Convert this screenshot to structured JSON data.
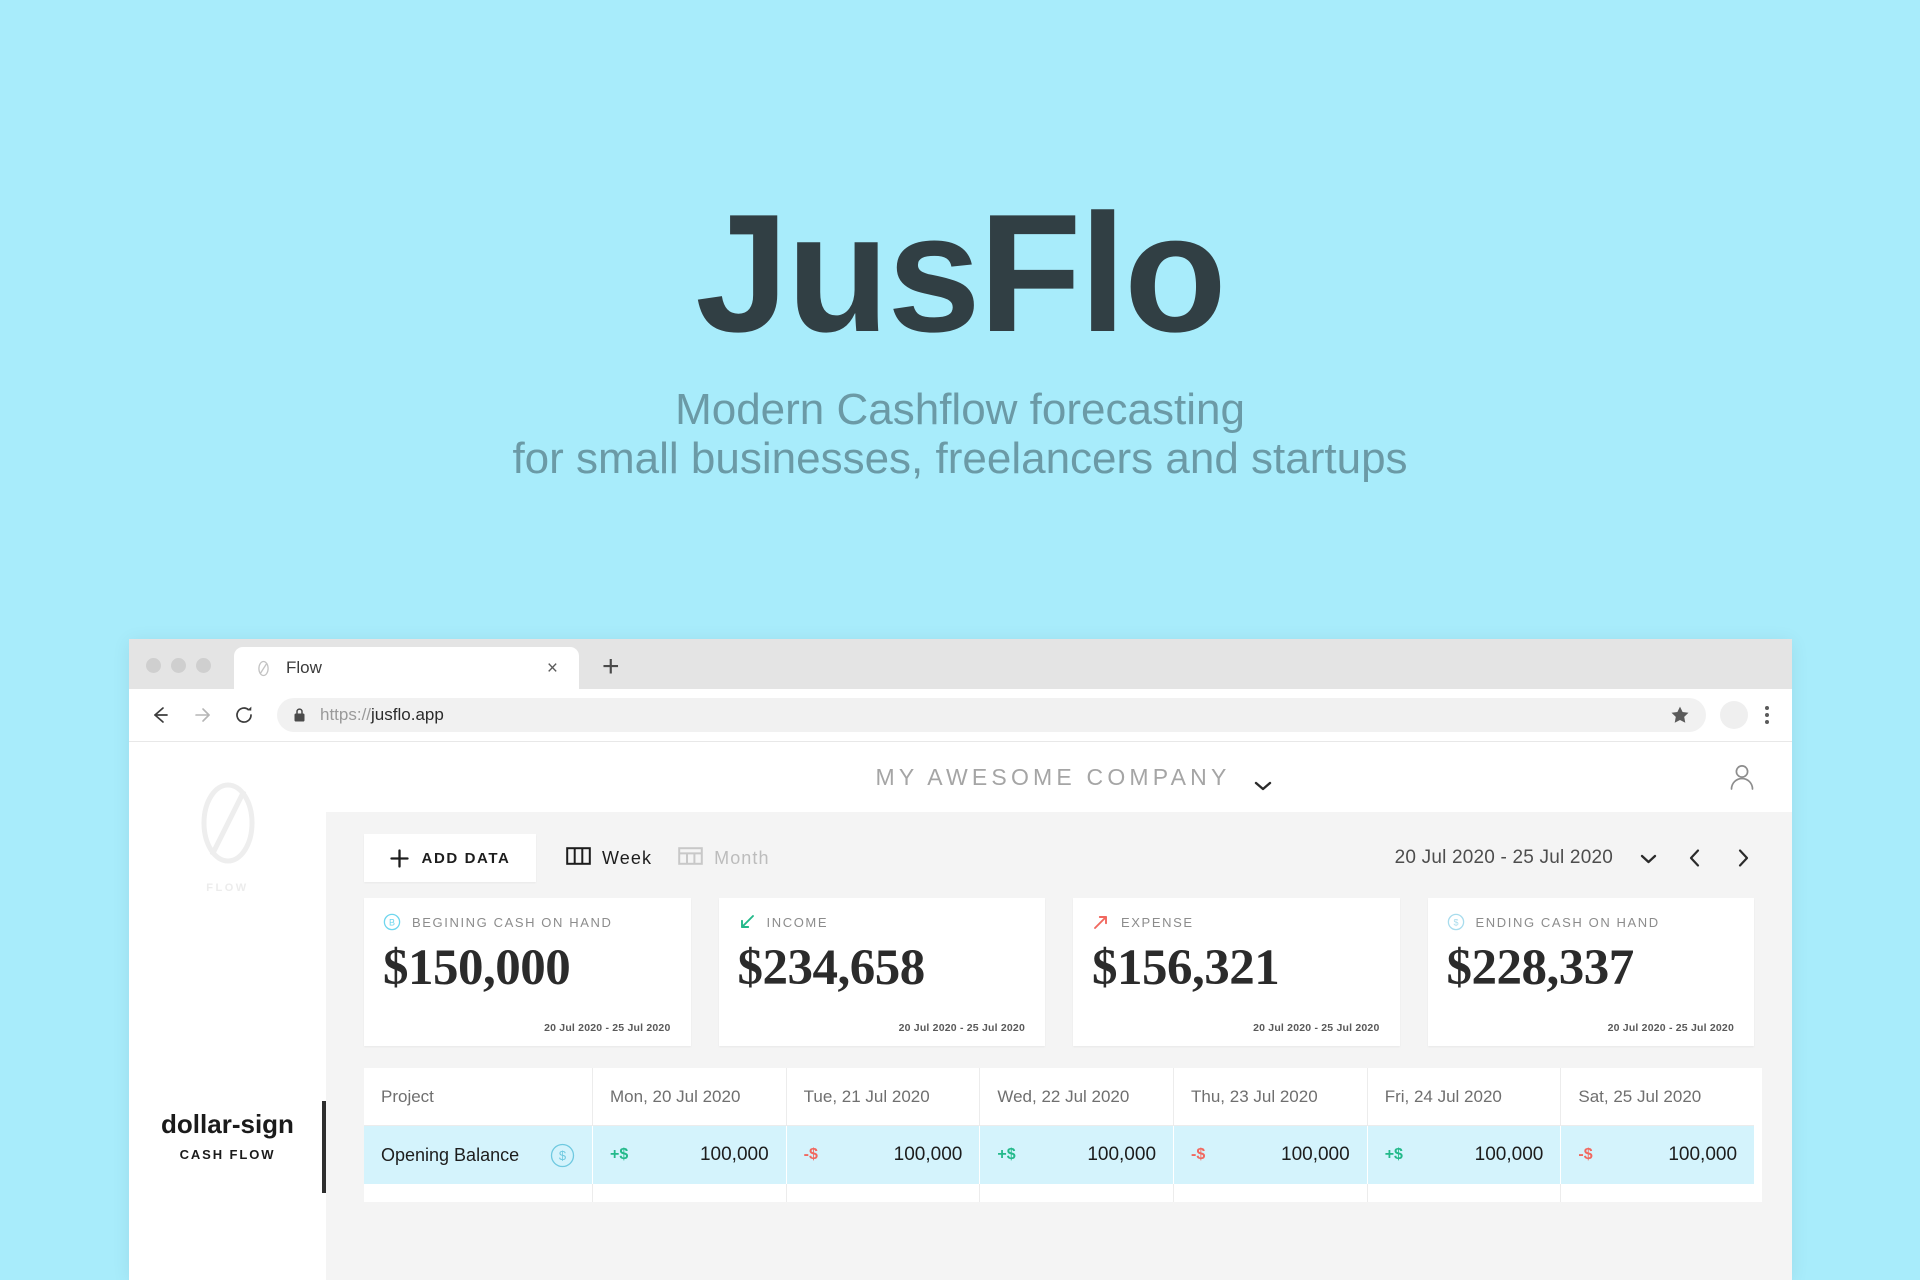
{
  "hero": {
    "title": "JusFlo",
    "tagline_line1": "Modern Cashflow forecasting",
    "tagline_line2": "for small businesses, freelancers and startups",
    "bg_color": "#a8ecfb",
    "title_color": "#313f44",
    "tagline_color": "#6b9aa6"
  },
  "browser": {
    "tab": {
      "title": "Flow",
      "favicon": "flow-zero-icon",
      "close_label": "×"
    },
    "new_tab_label": "+",
    "toolbar": {
      "back_icon": "arrow-left-icon",
      "forward_icon": "arrow-right-icon",
      "reload_icon": "reload-icon",
      "lock_icon": "lock-icon",
      "url_scheme": "https://",
      "url_host": "jusflo.app",
      "bookmark_icon": "star-icon",
      "profile_icon": "profile-avatar-icon",
      "menu_icon": "kebab-menu-icon"
    }
  },
  "app": {
    "sidebar": {
      "logo_label": "FLOW",
      "nav_items": [
        {
          "icon": "dollar-sign",
          "label": "CASH FLOW",
          "active": true
        }
      ]
    },
    "header": {
      "company": "MY AWESOME COMPANY",
      "company_chevron": "chevron-down-icon",
      "account_icon": "user-account-icon"
    },
    "toolbar": {
      "add_data_label": "ADD DATA",
      "add_data_icon": "plus-icon",
      "views": [
        {
          "label": "Week",
          "icon": "columns-view-icon",
          "active": true
        },
        {
          "label": "Month",
          "icon": "grid-view-icon",
          "active": false
        }
      ],
      "date_range": "20 Jul 2020 - 25 Jul 2020",
      "date_chevron": "chevron-down-icon",
      "prev_icon": "chevron-left-icon",
      "next_icon": "chevron-right-icon"
    },
    "cards": [
      {
        "label": "BEGINING CASH ON HAND",
        "value": "$150,000",
        "range": "20 Jul 2020 - 25 Jul 2020",
        "icon": "circled-b-icon",
        "icon_color": "#6fd6ee"
      },
      {
        "label": "INCOME",
        "value": "$234,658",
        "range": "20 Jul 2020 - 25 Jul 2020",
        "icon": "arrow-down-left-icon",
        "icon_color": "#23b98a"
      },
      {
        "label": "EXPENSE",
        "value": "$156,321",
        "range": "20 Jul 2020 - 25 Jul 2020",
        "icon": "arrow-up-right-icon",
        "icon_color": "#f1685f"
      },
      {
        "label": "ENDING CASH ON HAND",
        "value": "$228,337",
        "range": "20 Jul 2020 - 25 Jul 2020",
        "icon": "circled-dollar-icon",
        "icon_color": "#a8dced"
      }
    ],
    "table": {
      "columns": [
        "Project",
        "Mon, 20 Jul 2020",
        "Tue, 21 Jul 2020",
        "Wed, 22 Jul 2020",
        "Thu, 23 Jul 2020",
        "Fri, 24 Jul 2020",
        "Sat, 25 Jul 2020"
      ],
      "rows": [
        {
          "name": "Opening Balance",
          "badge": "circled-dollar-icon",
          "cells": [
            {
              "sign": "+$",
              "amount": "100,000",
              "positive": true
            },
            {
              "sign": "-$",
              "amount": "100,000",
              "positive": false
            },
            {
              "sign": "+$",
              "amount": "100,000",
              "positive": true
            },
            {
              "sign": "-$",
              "amount": "100,000",
              "positive": false
            },
            {
              "sign": "+$",
              "amount": "100,000",
              "positive": true
            },
            {
              "sign": "-$",
              "amount": "100,000",
              "positive": false
            }
          ]
        }
      ]
    }
  }
}
